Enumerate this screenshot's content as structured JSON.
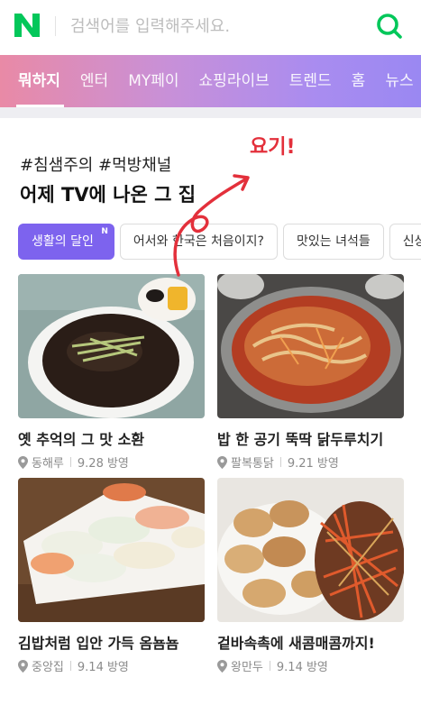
{
  "header": {
    "logo_letter": "N",
    "search_placeholder": "검색어를 입력해주세요."
  },
  "tabs": [
    "뭐하지",
    "엔터",
    "MY페이",
    "쇼핑라이브",
    "트렌드",
    "홈",
    "뉴스"
  ],
  "section": {
    "tagline": "#침샘주의 #먹방채널",
    "title": "어제 TV에 나온 그 집"
  },
  "chips": [
    {
      "label": "생활의 달인",
      "badge": "N",
      "active": true
    },
    {
      "label": "어서와 한국은 처음이지?"
    },
    {
      "label": "맛있는 녀석들"
    },
    {
      "label": "신상"
    }
  ],
  "cards": [
    {
      "title": "옛 추억의 그 맛 소환",
      "place": "동해루",
      "date": "9.28 방영",
      "image": "jjajangmyeon"
    },
    {
      "title": "밥 한 공기 뚝딱 닭두루치기",
      "place": "팔복통닭",
      "date": "9.21 방영",
      "image": "dakduruchigi"
    },
    {
      "title": "김밥처럼 입안 가득 옴뇸뇸",
      "place": "중앙집",
      "date": "9.14 방영",
      "image": "sushi"
    },
    {
      "title": "겉바속촉에 새콤매콤까지!",
      "place": "왕만두",
      "date": "9.14 방영",
      "image": "fried-dumplings"
    }
  ],
  "annotation": {
    "text": "요기!"
  },
  "colors": {
    "brand_green": "#03c75a",
    "accent_purple": "#7d63ee",
    "annotation_red": "#e3303b"
  }
}
